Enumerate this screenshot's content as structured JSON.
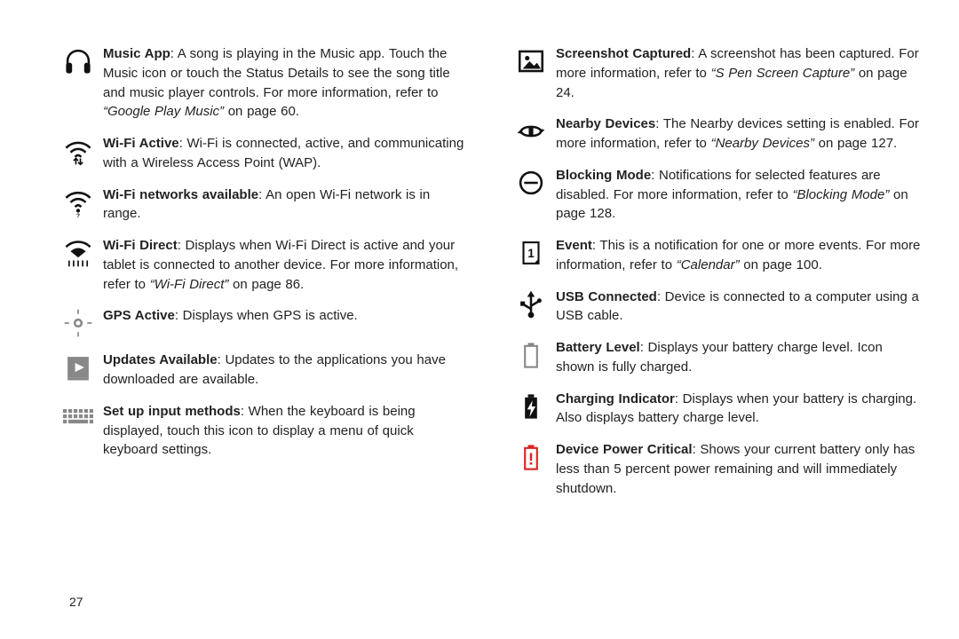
{
  "page_number": "27",
  "left": [
    {
      "icon": "headphones",
      "bold": "Music App",
      "plain": ": A song is playing in the Music app. Touch the Music icon or touch the Status Details to see the song title and music player controls. For more information, refer to ",
      "ref": "“Google Play Music”",
      "tail": " on page 60."
    },
    {
      "icon": "wifi-active",
      "bold": "Wi-Fi Active",
      "plain": ": Wi-Fi is connected, active, and communicating with a Wireless Access Point (WAP).",
      "ref": "",
      "tail": ""
    },
    {
      "icon": "wifi-avail",
      "bold": "Wi-Fi networks available",
      "plain": ": An open Wi-Fi network is in range.",
      "ref": "",
      "tail": ""
    },
    {
      "icon": "wifi-direct",
      "bold": "Wi-Fi Direct",
      "plain": ": Displays when Wi-Fi Direct is active and your tablet is connected to another device. For more information, refer to ",
      "ref": "“Wi-Fi Direct”",
      "tail": " on page 86."
    },
    {
      "icon": "gps",
      "bold": "GPS Active",
      "plain": ": Displays when GPS is active.",
      "ref": "",
      "tail": ""
    },
    {
      "icon": "updates",
      "bold": "Updates Available",
      "plain": ": Updates to the applications you have downloaded are available.",
      "ref": "",
      "tail": ""
    },
    {
      "icon": "keyboard",
      "bold": "Set up input methods",
      "plain": ": When the keyboard is being displayed, touch this icon to display a menu of quick keyboard settings.",
      "ref": "",
      "tail": ""
    }
  ],
  "right": [
    {
      "icon": "screenshot",
      "bold": "Screenshot Captured",
      "plain": ": A screenshot has been captured. For more information, refer to ",
      "ref": "“S Pen Screen Capture”",
      "tail": " on page 24."
    },
    {
      "icon": "nearby",
      "bold": "Nearby Devices",
      "plain": ": The Nearby devices setting is enabled. For more information, refer to ",
      "ref": "“Nearby Devices”",
      "tail": " on page 127."
    },
    {
      "icon": "blocking",
      "bold": "Blocking Mode",
      "plain": ": Notifications for selected features are disabled. For more information, refer to ",
      "ref": "“Blocking Mode”",
      "tail": " on page 128."
    },
    {
      "icon": "event",
      "bold": "Event",
      "plain": ": This is a notification for one or more events. For more information, refer to ",
      "ref": "“Calendar”",
      "tail": " on page 100."
    },
    {
      "icon": "usb",
      "bold": "USB Connected",
      "plain": ": Device is connected to a computer using a USB cable.",
      "ref": "",
      "tail": ""
    },
    {
      "icon": "battery",
      "bold": "Battery Level",
      "plain": ": Displays your battery charge level. Icon shown is fully charged.",
      "ref": "",
      "tail": ""
    },
    {
      "icon": "charging",
      "bold": "Charging Indicator",
      "plain": ": Displays when your battery is charging. Also displays battery charge level.",
      "ref": "",
      "tail": ""
    },
    {
      "icon": "critical",
      "bold": "Device Power Critical",
      "plain": ": Shows your current battery only has less than 5 percent power remaining and will immediately shutdown.",
      "ref": "",
      "tail": ""
    }
  ]
}
